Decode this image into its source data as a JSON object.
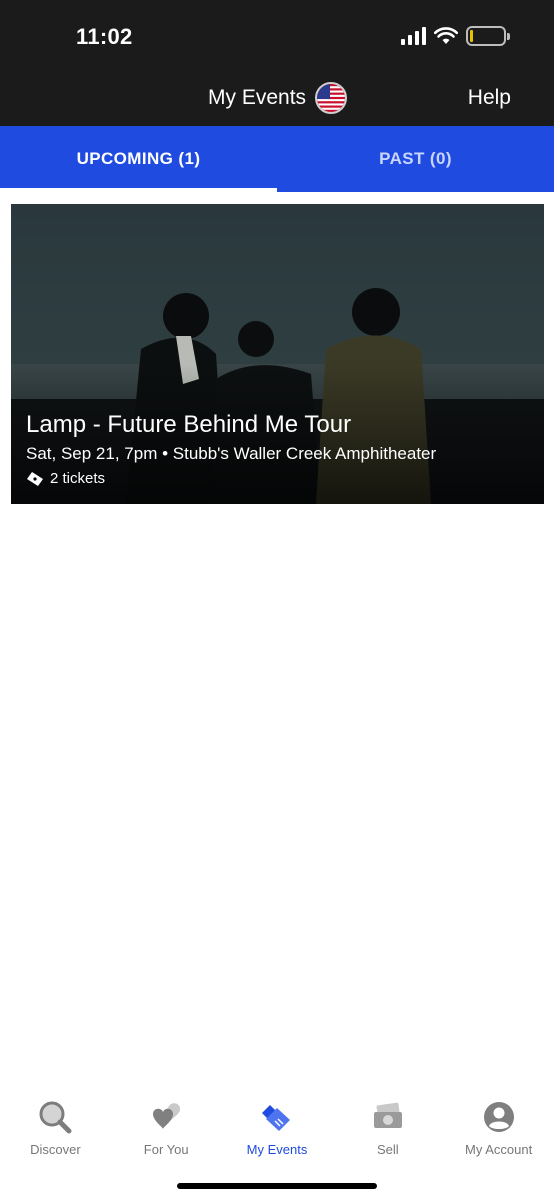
{
  "status_bar": {
    "time": "11:02"
  },
  "header": {
    "title": "My Events",
    "help_label": "Help",
    "flag_icon": "us-flag-icon"
  },
  "tabs": [
    {
      "label": "UPCOMING (1)",
      "active": true
    },
    {
      "label": "PAST (0)",
      "active": false
    }
  ],
  "event": {
    "title": "Lamp - Future Behind Me Tour",
    "meta": "Sat, Sep 21, 7pm • Stubb's Waller Creek Amphitheater",
    "tickets": "2 tickets"
  },
  "bottom_nav": [
    {
      "label": "Discover",
      "icon": "search-icon",
      "active": false
    },
    {
      "label": "For You",
      "icon": "hearts-icon",
      "active": false
    },
    {
      "label": "My Events",
      "icon": "ticket-icon",
      "active": true
    },
    {
      "label": "Sell",
      "icon": "money-icon",
      "active": false
    },
    {
      "label": "My Account",
      "icon": "account-icon",
      "active": false
    }
  ],
  "colors": {
    "accent": "#1f4be0",
    "header_bg": "#1b1b1b",
    "inactive_nav": "#777777"
  }
}
